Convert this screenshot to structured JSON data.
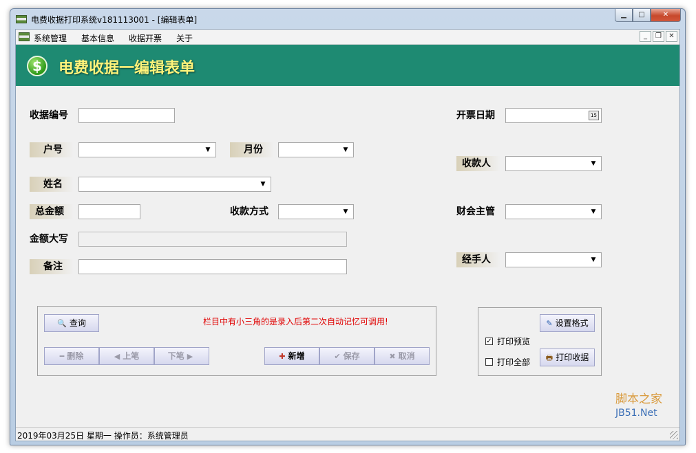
{
  "window": {
    "title": "电费收据打印系统v181113001 - [编辑表单]"
  },
  "menu": [
    "系统管理",
    "基本信息",
    "收据开票",
    "关于"
  ],
  "banner": {
    "title": "电费收据一编辑表单",
    "icon": "dollar-icon",
    "bg_color": "#1e8a72"
  },
  "form": {
    "receipt_no": {
      "label": "收据编号",
      "value": ""
    },
    "account_no": {
      "label": "户号",
      "value": ""
    },
    "month": {
      "label": "月份",
      "value": ""
    },
    "name": {
      "label": "姓名",
      "value": ""
    },
    "total": {
      "label": "总金额",
      "value": ""
    },
    "payment_method": {
      "label": "收款方式",
      "value": ""
    },
    "amount_words": {
      "label": "金额大写",
      "value": ""
    },
    "remark": {
      "label": "备注",
      "value": ""
    },
    "invoice_date": {
      "label": "开票日期",
      "value": ""
    },
    "payee": {
      "label": "收款人",
      "value": ""
    },
    "finance_manager": {
      "label": "财会主管",
      "value": ""
    },
    "handler": {
      "label": "经手人",
      "value": ""
    }
  },
  "actions": {
    "query": "查询",
    "hint": "栏目中有小三角的是录入后第二次自动记忆可调用!",
    "delete": "删除",
    "prev": "上笔",
    "next": "下笔",
    "add": "新增",
    "save": "保存",
    "cancel": "取消"
  },
  "print": {
    "set_format": "设置格式",
    "preview_label": "打印预览",
    "preview_checked": true,
    "print_all_label": "打印全部",
    "print_all_checked": false,
    "print_receipt": "打印收据"
  },
  "watermark": {
    "line1": "脚本之家",
    "line2": "JB51.Net"
  },
  "status": "2019年03月25日  星期一  操作员：系统管理员"
}
